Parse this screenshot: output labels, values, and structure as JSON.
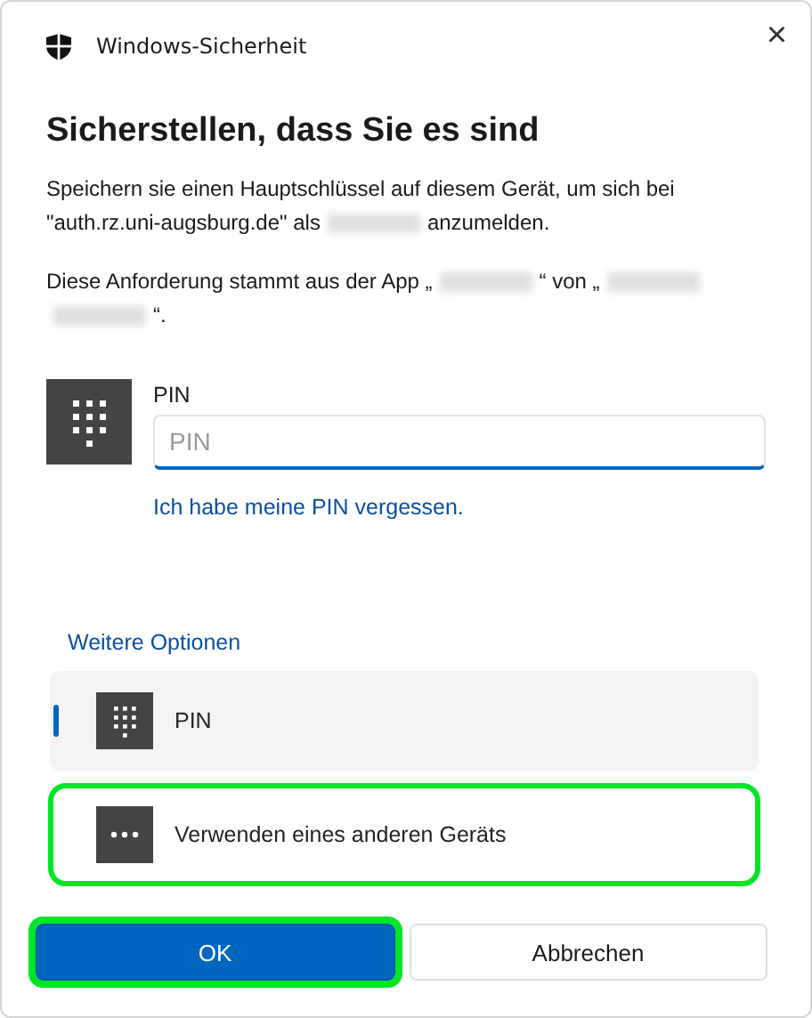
{
  "window": {
    "title": "Windows-Sicherheit",
    "close": "×"
  },
  "heading": "Sicherstellen, dass Sie es sind",
  "paragraphs": [
    [
      [
        {
          "kind": "text",
          "text": "Speichern sie einen Hauptschlüssel auf diesem Gerät, um sich bei"
        }
      ],
      [
        {
          "kind": "text",
          "text": "\"auth.rz.uni-augsburg.de\" als"
        },
        {
          "kind": "blur"
        },
        {
          "kind": "text",
          "text": "anzumelden."
        }
      ]
    ],
    [
      [
        {
          "kind": "text",
          "text": "Diese Anforderung stammt aus der App „"
        },
        {
          "kind": "blur"
        },
        {
          "kind": "text",
          "text": "“ von „"
        },
        {
          "kind": "blur"
        }
      ],
      [
        {
          "kind": "blur"
        },
        {
          "kind": "text",
          "text": "“."
        }
      ]
    ]
  ],
  "pin": {
    "label": "PIN",
    "placeholder": "PIN",
    "forgot_link": "Ich habe meine PIN vergessen."
  },
  "more_options": "Weitere Optionen",
  "options": [
    {
      "kind": "keypad",
      "label": "PIN",
      "selected": true,
      "highlighted": false
    },
    {
      "kind": "dots",
      "label": "Verwenden eines anderen Geräts",
      "selected": false,
      "highlighted": true
    }
  ],
  "buttons": [
    {
      "label": "OK",
      "primary": true,
      "highlighted": true
    },
    {
      "label": "Abbrechen",
      "primary": false,
      "highlighted": false
    }
  ]
}
